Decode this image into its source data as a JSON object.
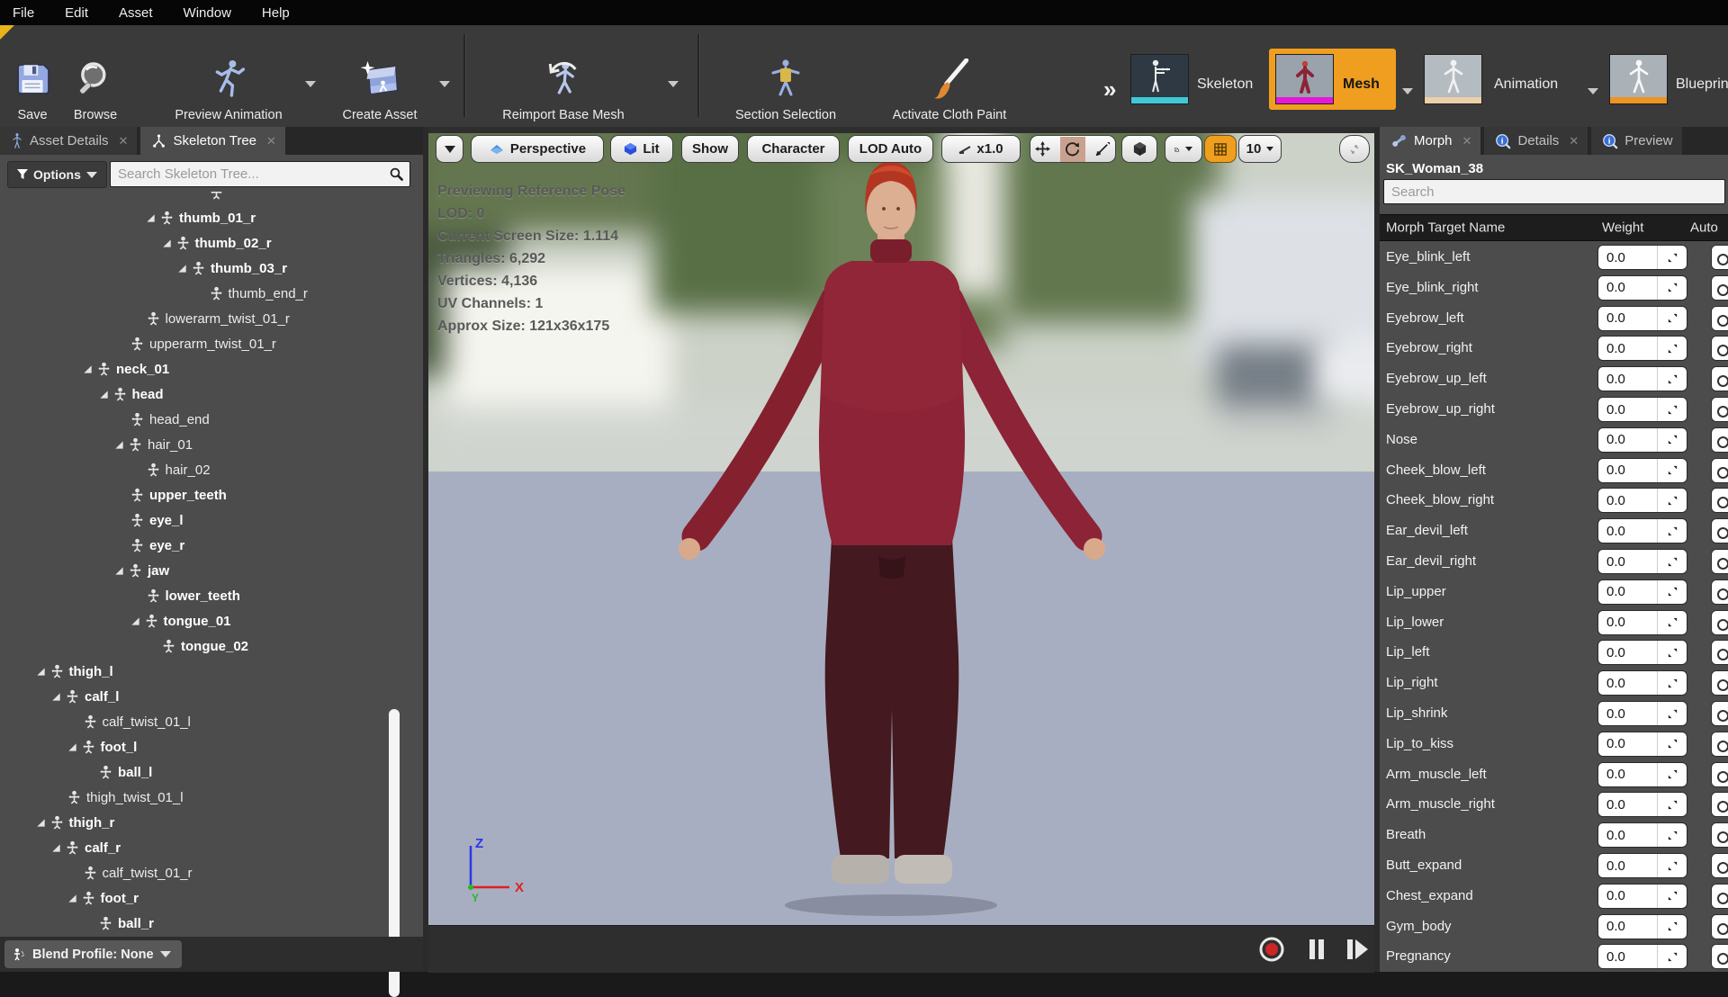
{
  "menu": {
    "items": [
      "File",
      "Edit",
      "Asset",
      "Window",
      "Help"
    ]
  },
  "toolbar": {
    "accent_color": "#f09e1f",
    "buttons": [
      {
        "id": "save",
        "label": "Save",
        "icon": "save-icon",
        "dropdown": false
      },
      {
        "id": "browse",
        "label": "Browse",
        "icon": "browse-icon",
        "dropdown": false
      },
      {
        "id": "preview-animation",
        "label": "Preview Animation",
        "icon": "preview-animation-icon",
        "dropdown": true
      },
      {
        "id": "create-asset",
        "label": "Create Asset",
        "icon": "create-asset-icon",
        "dropdown": true
      },
      {
        "id": "reimport-base-mesh",
        "label": "Reimport Base Mesh",
        "icon": "reimport-base-mesh-icon",
        "dropdown": true
      },
      {
        "id": "section-selection",
        "label": "Section Selection",
        "icon": "section-selection-icon",
        "dropdown": false
      },
      {
        "id": "activate-cloth-paint",
        "label": "Activate Cloth Paint",
        "icon": "activate-cloth-paint-icon",
        "dropdown": false
      }
    ],
    "overflow_chevron": "»",
    "modes": [
      {
        "id": "skeleton",
        "label": "Skeleton",
        "active": false,
        "strip_color": "#41c8d6",
        "dropdown": false
      },
      {
        "id": "mesh",
        "label": "Mesh",
        "active": true,
        "strip_color": "#e518d8",
        "dropdown": true
      },
      {
        "id": "animation",
        "label": "Animation",
        "active": false,
        "strip_color": "#ecd0a8",
        "dropdown": true
      },
      {
        "id": "blueprint",
        "label": "Blueprint",
        "active": false,
        "strip_color": "#ef9422",
        "dropdown": false
      }
    ]
  },
  "left_panel": {
    "tabs": [
      {
        "label": "Asset Details",
        "active": false
      },
      {
        "label": "Skeleton Tree",
        "active": true
      }
    ],
    "options_label": "Options",
    "search_placeholder": "Search Skeleton Tree...",
    "blend_profile_label": "Blend Profile: None",
    "tree": [
      {
        "name": "",
        "depth": 11,
        "bold": false,
        "arrow": false
      },
      {
        "name": "thumb_01_r",
        "depth": 8,
        "bold": true,
        "arrow": true
      },
      {
        "name": "thumb_02_r",
        "depth": 9,
        "bold": true,
        "arrow": true
      },
      {
        "name": "thumb_03_r",
        "depth": 10,
        "bold": true,
        "arrow": true
      },
      {
        "name": "thumb_end_r",
        "depth": 11,
        "bold": false,
        "arrow": false
      },
      {
        "name": "lowerarm_twist_01_r",
        "depth": 7,
        "bold": false,
        "arrow": false
      },
      {
        "name": "upperarm_twist_01_r",
        "depth": 6,
        "bold": false,
        "arrow": false
      },
      {
        "name": "neck_01",
        "depth": 4,
        "bold": true,
        "arrow": true
      },
      {
        "name": "head",
        "depth": 5,
        "bold": true,
        "arrow": true
      },
      {
        "name": "head_end",
        "depth": 6,
        "bold": false,
        "arrow": false
      },
      {
        "name": "hair_01",
        "depth": 6,
        "bold": false,
        "arrow": true
      },
      {
        "name": "hair_02",
        "depth": 7,
        "bold": false,
        "arrow": false
      },
      {
        "name": "upper_teeth",
        "depth": 6,
        "bold": true,
        "arrow": false
      },
      {
        "name": "eye_l",
        "depth": 6,
        "bold": true,
        "arrow": false
      },
      {
        "name": "eye_r",
        "depth": 6,
        "bold": true,
        "arrow": false
      },
      {
        "name": "jaw",
        "depth": 6,
        "bold": true,
        "arrow": true
      },
      {
        "name": "lower_teeth",
        "depth": 7,
        "bold": true,
        "arrow": false
      },
      {
        "name": "tongue_01",
        "depth": 7,
        "bold": true,
        "arrow": true
      },
      {
        "name": "tongue_02",
        "depth": 8,
        "bold": true,
        "arrow": false
      },
      {
        "name": "thigh_l",
        "depth": 1,
        "bold": true,
        "arrow": true
      },
      {
        "name": "calf_l",
        "depth": 2,
        "bold": true,
        "arrow": true
      },
      {
        "name": "calf_twist_01_l",
        "depth": 3,
        "bold": false,
        "arrow": false
      },
      {
        "name": "foot_l",
        "depth": 3,
        "bold": true,
        "arrow": true
      },
      {
        "name": "ball_l",
        "depth": 4,
        "bold": true,
        "arrow": false
      },
      {
        "name": "thigh_twist_01_l",
        "depth": 2,
        "bold": false,
        "arrow": false
      },
      {
        "name": "thigh_r",
        "depth": 1,
        "bold": true,
        "arrow": true
      },
      {
        "name": "calf_r",
        "depth": 2,
        "bold": true,
        "arrow": true
      },
      {
        "name": "calf_twist_01_r",
        "depth": 3,
        "bold": false,
        "arrow": false
      },
      {
        "name": "foot_r",
        "depth": 3,
        "bold": true,
        "arrow": true
      },
      {
        "name": "ball_r",
        "depth": 4,
        "bold": true,
        "arrow": false
      }
    ]
  },
  "viewport": {
    "toolbar": {
      "perspective": "Perspective",
      "lit": "Lit",
      "show": "Show",
      "character": "Character",
      "lod": "LOD Auto",
      "speed": "x1.0",
      "snap_value": "10"
    },
    "stats": [
      "Previewing Reference Pose",
      "LOD: 0",
      "Current Screen Size: 1.114",
      "Triangles: 6,292",
      "Vertices: 4,136",
      "UV Channels: 1",
      "Approx Size: 121x36x175"
    ],
    "axis_labels": {
      "x": "X",
      "y": "Y",
      "z": "Z"
    }
  },
  "right_panel": {
    "tabs": [
      {
        "label": "Morph",
        "active": true
      },
      {
        "label": "Details",
        "active": false
      },
      {
        "label": "Preview",
        "active": false
      }
    ],
    "asset_name": "SK_Woman_38",
    "search_placeholder": "Search",
    "columns": [
      "Morph Target Name",
      "Weight",
      "Auto"
    ],
    "weight_value": "0.0",
    "morph_targets": [
      "Eye_blink_left",
      "Eye_blink_right",
      "Eyebrow_left",
      "Eyebrow_right",
      "Eyebrow_up_left",
      "Eyebrow_up_right",
      "Nose",
      "Cheek_blow_left",
      "Cheek_blow_right",
      "Ear_devil_left",
      "Ear_devil_right",
      "Lip_upper",
      "Lip_lower",
      "Lip_left",
      "Lip_right",
      "Lip_shrink",
      "Lip_to_kiss",
      "Arm_muscle_left",
      "Arm_muscle_right",
      "Breath",
      "Butt_expand",
      "Chest_expand",
      "Gym_body",
      "Pregnancy"
    ]
  }
}
